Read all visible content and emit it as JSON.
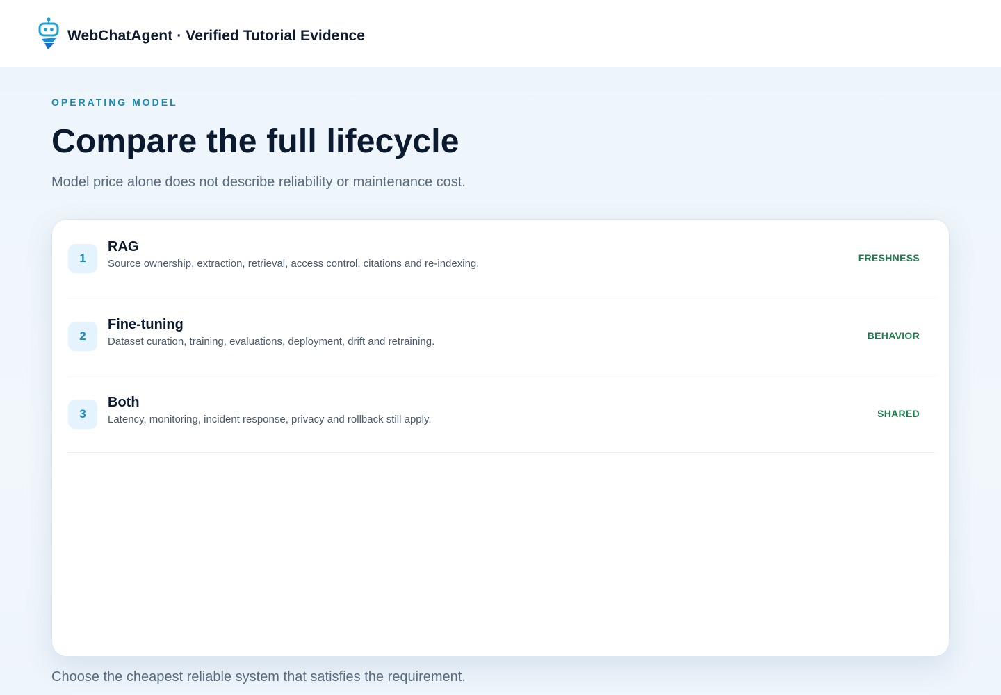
{
  "header": {
    "brand": "WebChatAgent · Verified Tutorial Evidence",
    "logo_icon": "robot-icon",
    "accent_color": "#1aa3d6"
  },
  "hero": {
    "eyebrow": "OPERATING MODEL",
    "title": "Compare the full lifecycle",
    "subtitle": "Model price alone does not describe reliability or maintenance cost."
  },
  "comparison": {
    "rows": [
      {
        "number": "1",
        "title": "RAG",
        "description": "Source ownership, extraction, retrieval, access control, citations and re-indexing.",
        "tag": "FRESHNESS"
      },
      {
        "number": "2",
        "title": "Fine-tuning",
        "description": "Dataset curation, training, evaluations, deployment, drift and retraining.",
        "tag": "BEHAVIOR"
      },
      {
        "number": "3",
        "title": "Both",
        "description": "Latency, monitoring, incident response, privacy and rollback still apply.",
        "tag": "SHARED"
      }
    ],
    "tag_color": "#1b7f4a",
    "number_color": "#1a8bb8"
  },
  "footer": {
    "note": "Choose the cheapest reliable system that satisfies the requirement."
  }
}
